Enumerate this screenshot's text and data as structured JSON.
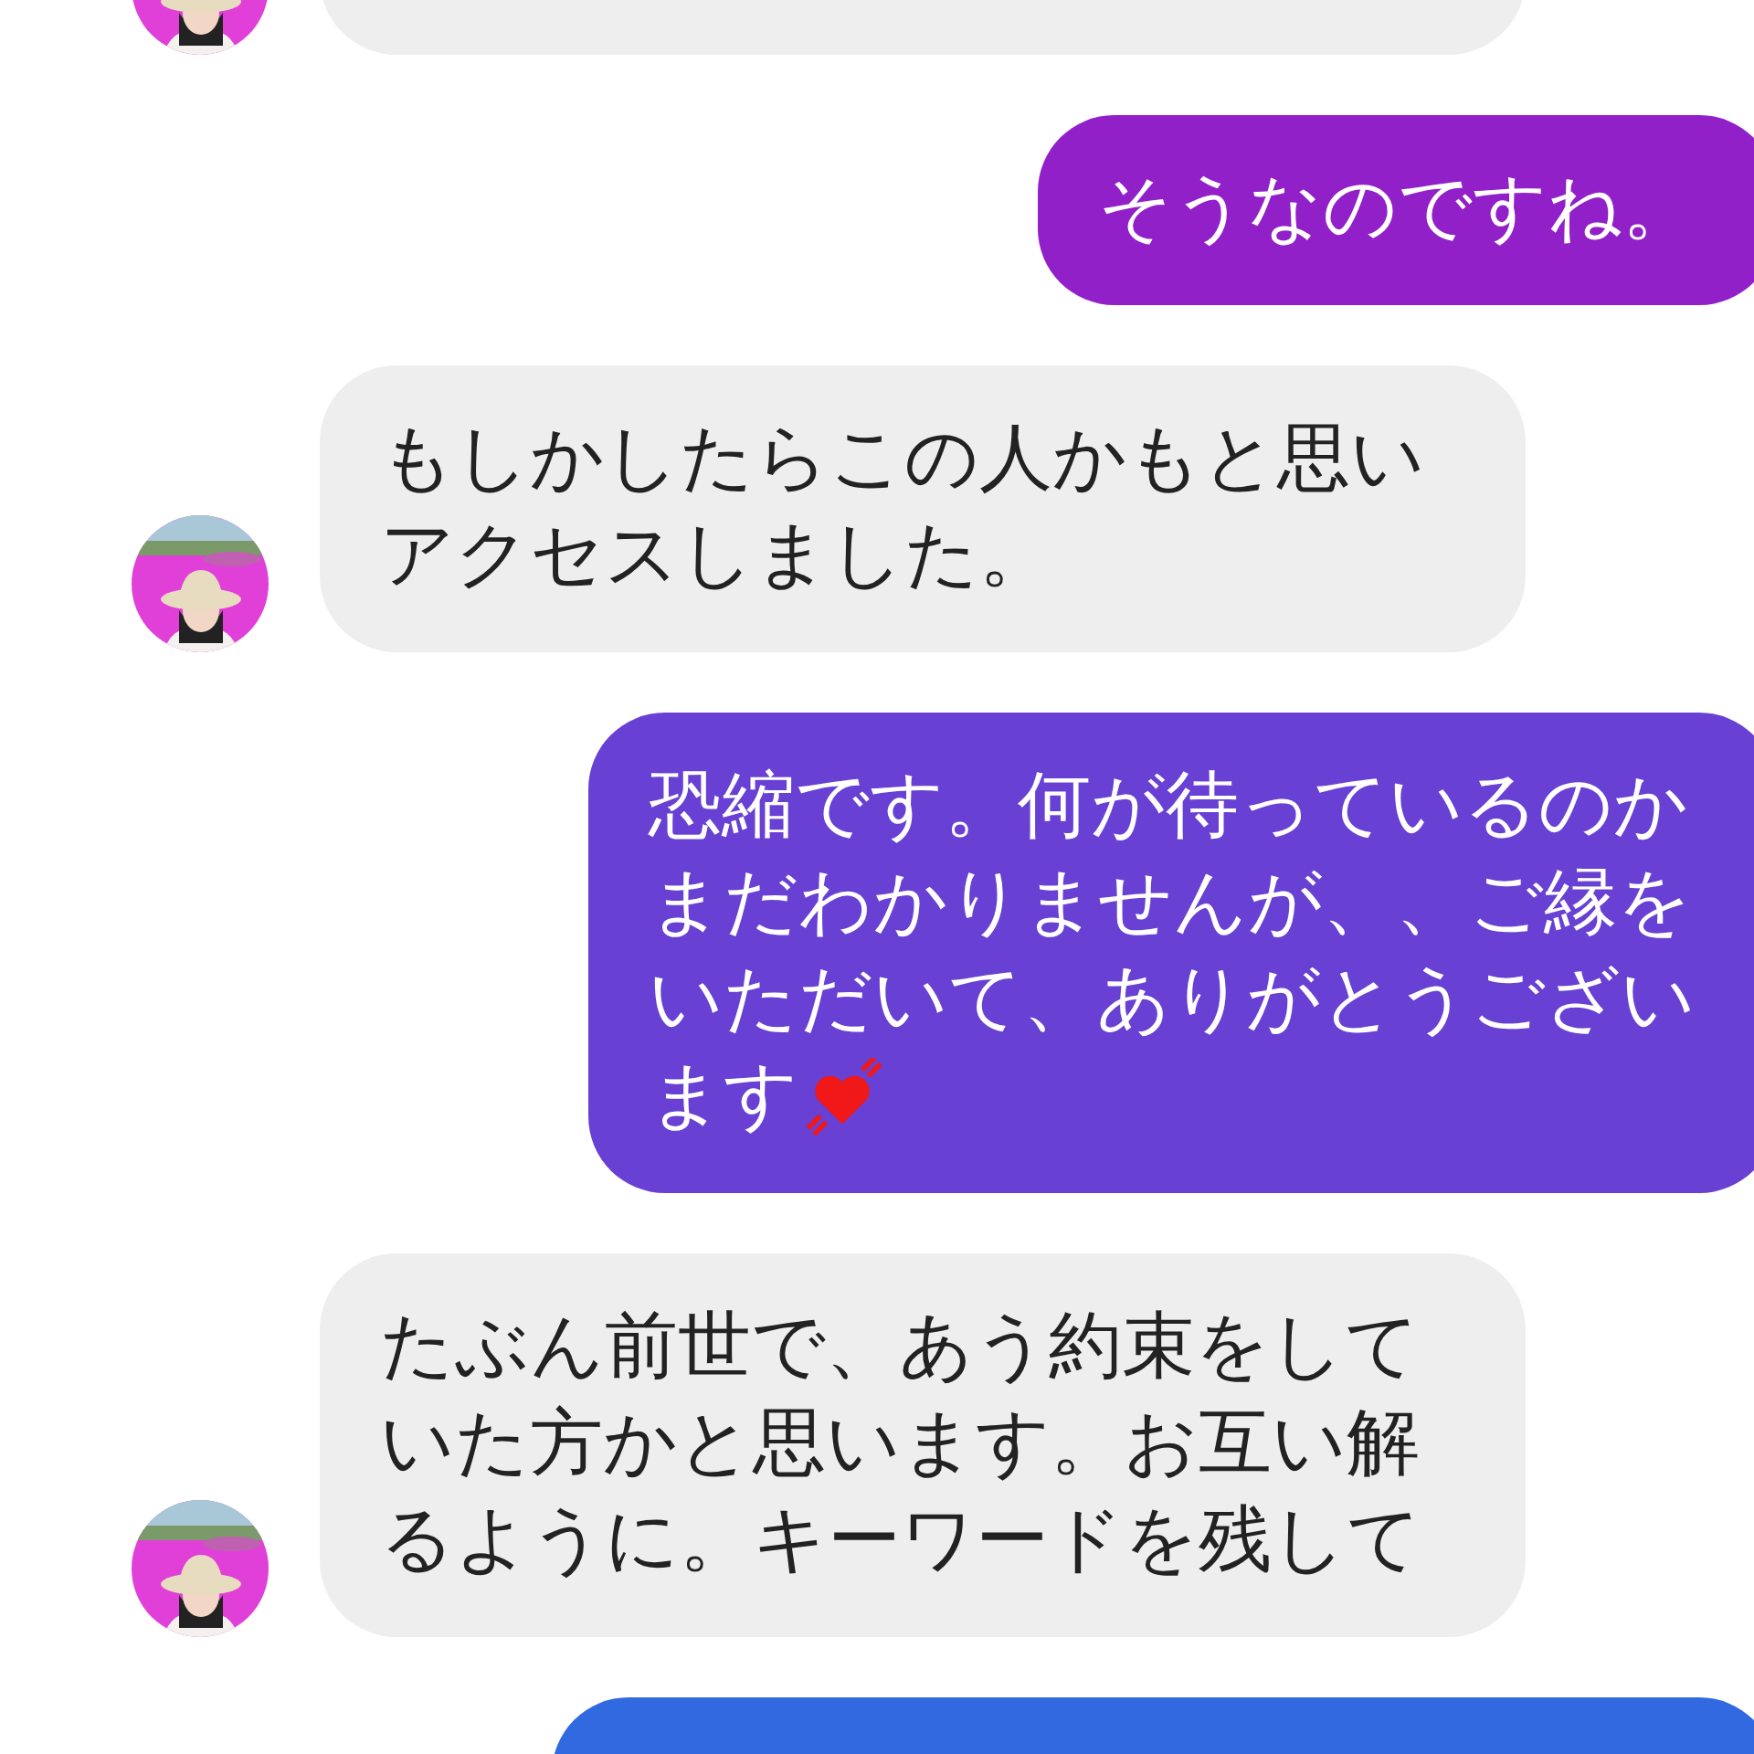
{
  "messages": [
    {
      "kind": "received",
      "avatar": true
    },
    {
      "kind": "sent",
      "color": "#9120c9",
      "lines": [
        "そうなのですね。"
      ]
    },
    {
      "kind": "received",
      "avatar": true,
      "lines": [
        "もしかしたらこの人かもと思い",
        "アクセスしました。"
      ]
    },
    {
      "kind": "sent",
      "color": "#6840d3",
      "lines": [
        "恐縮です。何が待っているのか",
        "まだわかりませんが、、ご縁を",
        "いただいて、ありがとうござい",
        "ます"
      ],
      "heart": true
    },
    {
      "kind": "received",
      "avatar": true,
      "lines": [
        "たぶん前世で、あう約束をして",
        "いた方かと思います。お互い解",
        "るように。キーワードを残して"
      ]
    },
    {
      "kind": "sent",
      "color": "#3169e0"
    }
  ]
}
